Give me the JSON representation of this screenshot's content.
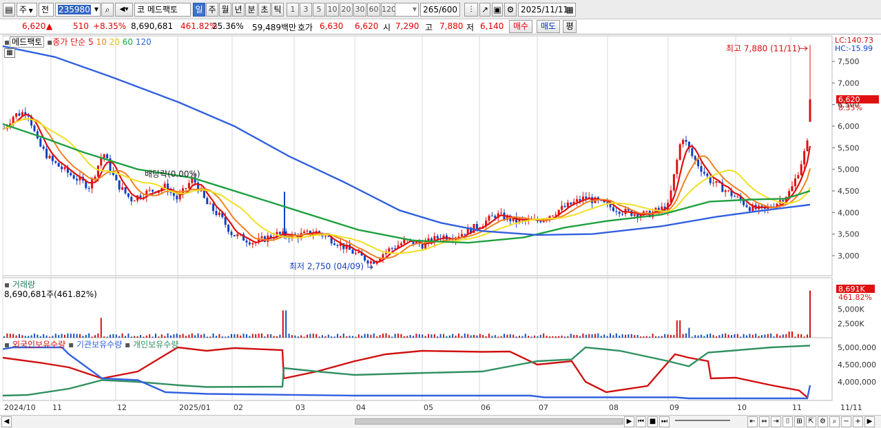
{
  "toolbar": {
    "market_label": "주",
    "mode_label": "전",
    "stock_code": "235980",
    "stock_code_prefix": "코",
    "stock_name": "메드팩토",
    "period_tabs": [
      "일",
      "주",
      "월",
      "년",
      "분",
      "초",
      "틱"
    ],
    "selected_period": "일",
    "interval_buttons": [
      "1",
      "3",
      "5",
      "10",
      "20",
      "30",
      "60",
      "120"
    ],
    "count_display": "265",
    "count_total": "/600",
    "date": "2025/11/11"
  },
  "quote": {
    "price": "6,620",
    "change_arrow": "▲",
    "change": "510",
    "change_pct": "+8.35%",
    "volume": "8,690,681",
    "volume_ratio": "461.82%",
    "turnover": "25.36%",
    "amount": "59,489백만",
    "bid_label": "호가",
    "ask": "6,630",
    "bid": "6,620",
    "open_label": "시",
    "open": "7,290",
    "high_label": "고",
    "high": "7,880",
    "low_label": "저",
    "low": "6,140",
    "buy_button": "매수",
    "sell_button": "매도",
    "eval_button": "평"
  },
  "price_panel": {
    "legend_name": "메드팩토",
    "legend_ma": "종가 단순",
    "ma_periods": [
      "5",
      "10",
      "20",
      "60",
      "120"
    ],
    "ma_colors": [
      "#e01010",
      "#f08020",
      "#f0e020",
      "#20a040",
      "#3060e0"
    ],
    "lc": "LC:140.73",
    "hc": "HC:-15.99",
    "current_price_tag": "6,620",
    "current_pct_tag": "8.35%",
    "max_label": "최고 7,880 (11/11)",
    "min_label": "최저 2,750 (04/09)",
    "dividend_label": "배당락(0.00%)",
    "y_ticks": [
      "7,500",
      "7,000",
      "6,500",
      "6,000",
      "5,500",
      "5,000",
      "4,500",
      "4,000",
      "3,500",
      "3,000"
    ]
  },
  "volume_panel": {
    "title": "거래량",
    "value_text": "8,690,681주(461.82%)",
    "tag_value": "8,691K",
    "tag_pct": "461.82%",
    "y_ticks": [
      "5,000K",
      "2,500K"
    ]
  },
  "holding_panel": {
    "legend": [
      "외국인보유수량",
      "기관보유수량",
      "개인보유수량"
    ],
    "colors": [
      "#d01010",
      "#3060e0",
      "#309060"
    ],
    "y_ticks": [
      "5,000,000",
      "4,500,000",
      "4,000,000"
    ]
  },
  "x_axis": {
    "labels": [
      "2024/10",
      "11",
      "12",
      "2025/01",
      "02",
      "03",
      "04",
      "05",
      "06",
      "07",
      "08",
      "09",
      "10",
      "11"
    ],
    "last_date": "11/11"
  },
  "chart_data": {
    "type": "candlestick",
    "price_axis": {
      "min": 2750,
      "max": 7880
    },
    "approx_closes_by_month": [
      {
        "month": "2024/10",
        "close": 5900
      },
      {
        "month": "11",
        "close": 4700
      },
      {
        "month": "12",
        "close": 4500
      },
      {
        "month": "2025/01",
        "close": 4700
      },
      {
        "month": "02",
        "close": 3500
      },
      {
        "month": "03",
        "close": 3500
      },
      {
        "month": "04",
        "close": 2900
      },
      {
        "month": "05",
        "close": 3300
      },
      {
        "month": "06",
        "close": 3900
      },
      {
        "month": "07",
        "close": 4000
      },
      {
        "month": "08",
        "close": 4050
      },
      {
        "month": "09",
        "close": 5200
      },
      {
        "month": "10",
        "close": 4000
      },
      {
        "month": "11",
        "close": 6620
      }
    ],
    "high": 7880,
    "low": 2750
  }
}
